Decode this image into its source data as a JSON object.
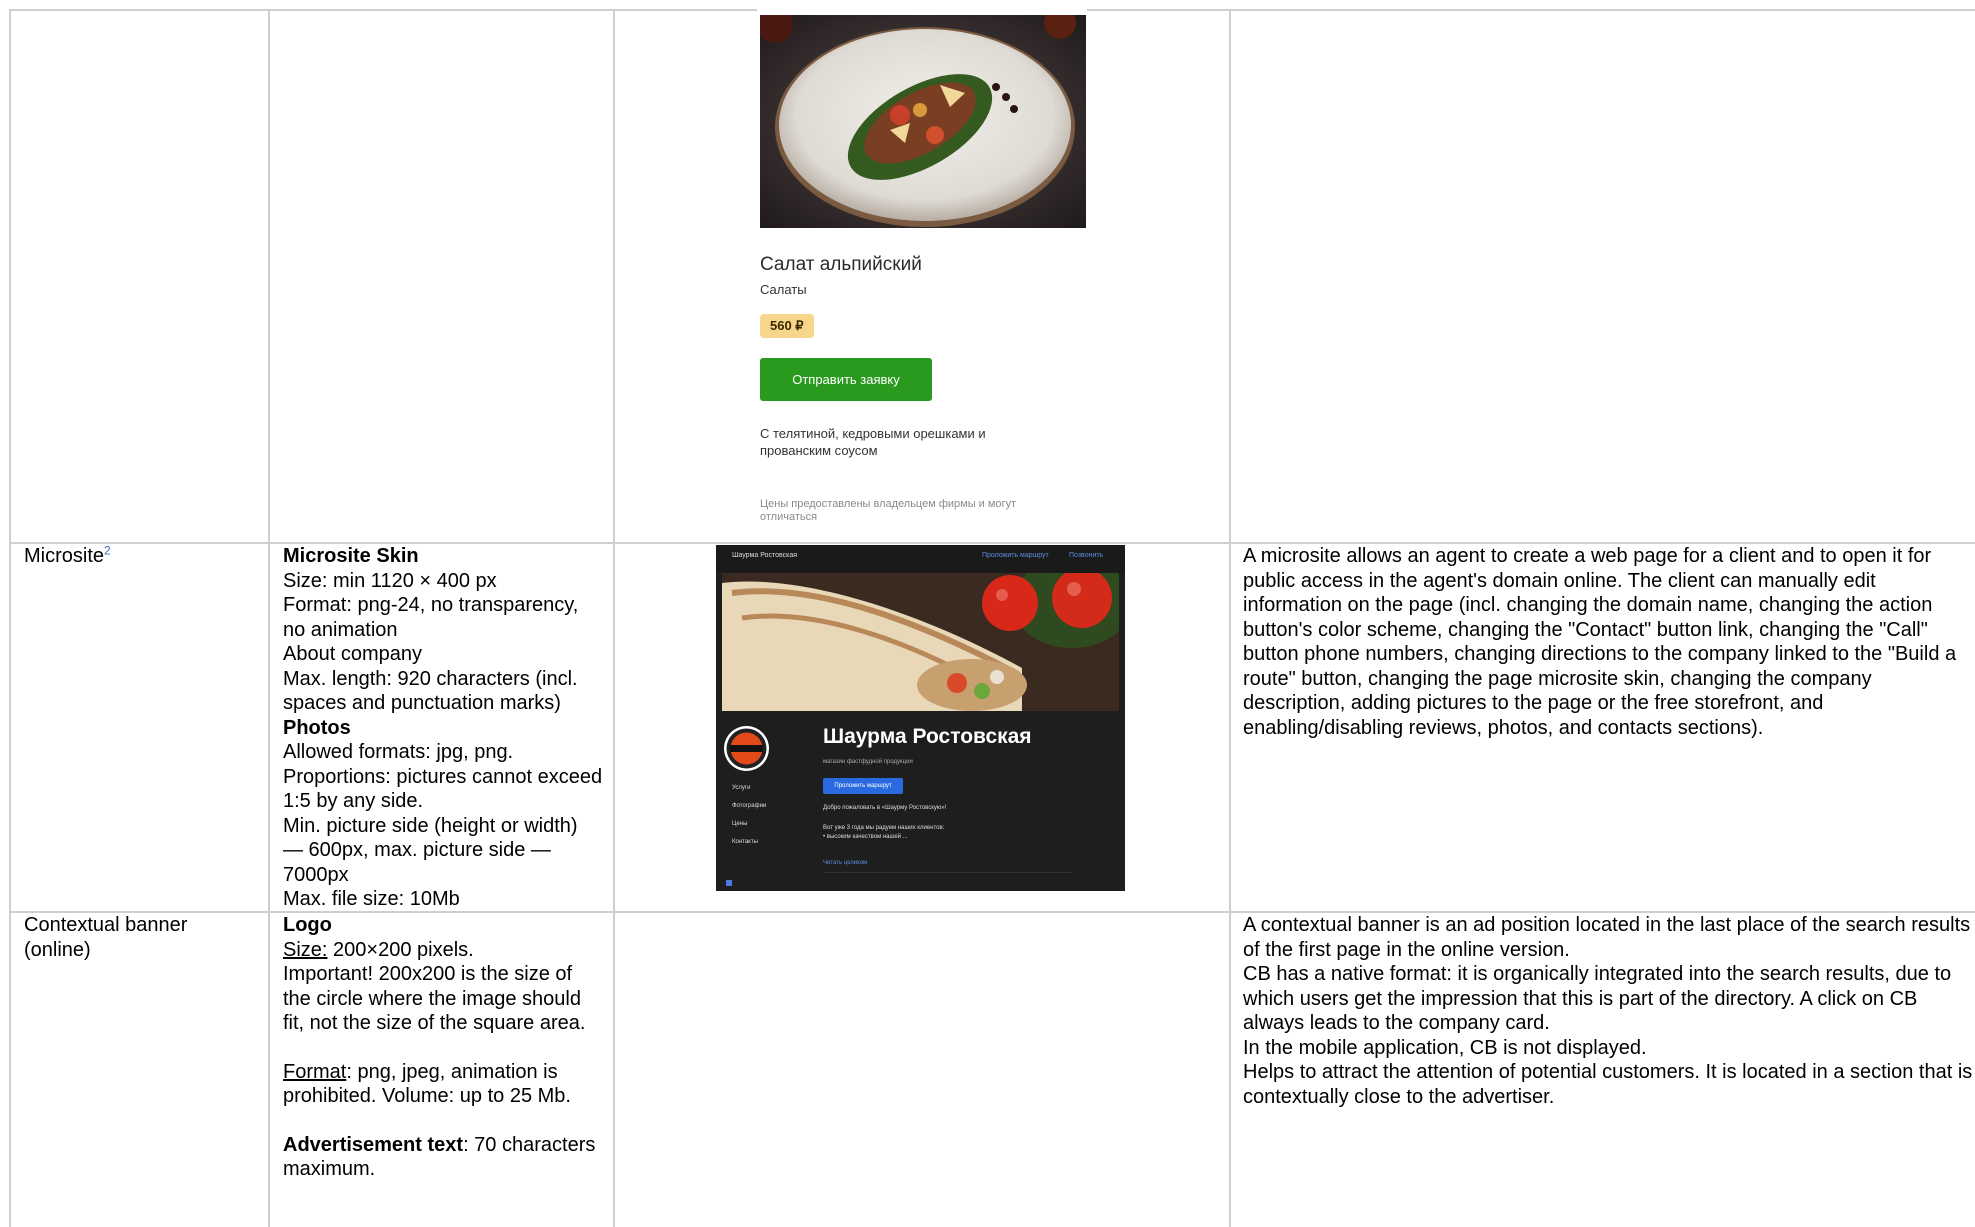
{
  "menu_card": {
    "dish_name": "Салат альпийский",
    "category": "Салаты",
    "price": "560 ₽",
    "order_button": "Отправить заявку",
    "description": "С телятиной, кедровыми орешками и прованским соусом",
    "note": "Цены предоставлены владельцем фирмы и могут отличаться"
  },
  "microsite_row": {
    "name": "Microsite",
    "footnote": "2",
    "requirements": {
      "skin_heading": "Microsite Skin",
      "skin_size": "Size: min 1120 × 400 px",
      "skin_format": "Format: png-24, no transparency, no animation",
      "about_heading": "About company",
      "about_length": "Max. length: 920 characters (incl. spaces and punctuation marks)",
      "photos_heading": "Photos",
      "photos_formats": "Allowed formats: jpg, png.",
      "photos_proportions": "Proportions: pictures cannot exceed 1:5 by any side.",
      "photos_sides": "Min. picture side (height or width) — 600px, max. picture side — 7000px",
      "photos_filesize": "Max. file size: 10Mb"
    },
    "preview": {
      "brand": "Шаурма Ростовская",
      "build_route": "Проложить маршрут",
      "call": "Позвонить",
      "title": "Шаурма Ростовская",
      "subtitle": "магазин фастфудной продукции",
      "route_button": "Проложить маршрут",
      "menu": [
        "Услуги",
        "Фотографии",
        "Цены",
        "Контакты"
      ],
      "welcome": "Добро пожаловать в «Шаурму Ростовскую»!",
      "body_1": "Вот уже 3 года мы радуем наших клиентов:",
      "body_2": "• высоким качеством нашей ...",
      "read_more": "Читать целиком"
    },
    "description": "A microsite allows an agent to create a web page for a client and to open it for public access in the agent's domain online. The client can manually edit information on the page (incl. changing the domain name, changing the action button's color scheme, changing the \"Contact\" button link, changing the \"Call\" button phone numbers, changing directions to the company linked to the \"Build a route\" button, changing the page microsite skin, changing the company description, adding pictures to the page or the free storefront, and enabling/disabling reviews, photos, and contacts sections)."
  },
  "banner_row": {
    "name": "Contextual banner (online)",
    "requirements": {
      "logo_heading": "Logo",
      "size_label": "Size:",
      "size_value": " 200×200 pixels.",
      "important": "Important! 200x200 is the size of the circle where the image should fit, not the size of the square area.",
      "format_label": "Format",
      "format_value": ": png, jpeg, animation is prohibited. Volume: up to 25 Mb.",
      "adtext_label": "Advertisement text",
      "adtext_value": ": 70 characters maximum."
    },
    "description": [
      "A contextual banner is an ad position located in the last place of the search results of the first page in the online version.",
      "CB has a native format: it is organically integrated into the search results, due to which users get the impression that this is part of the directory. A click on CB always leads to the company card.",
      "In the mobile application, CB is not displayed.",
      "Helps to attract the attention of potential customers. It is located in a section that is contextually close to the advertiser."
    ]
  }
}
